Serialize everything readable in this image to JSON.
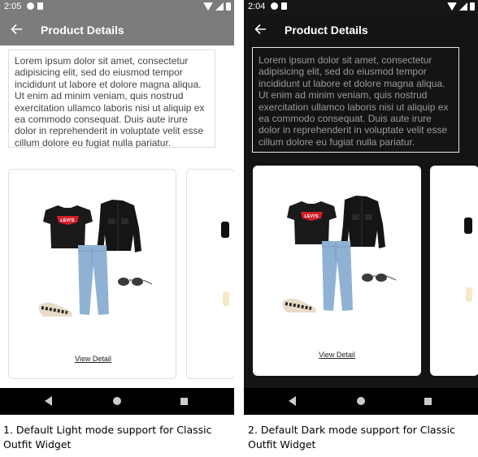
{
  "screens": [
    {
      "mode": "light",
      "status_time": "2:05",
      "header_title": "Product Details",
      "description": "Lorem ipsum dolor sit amet, consectetur adipisicing elit, sed do eiusmod tempor incididunt ut labore et dolore magna aliqua. Ut enim ad minim veniam, quis nostrud exercitation ullamco laboris nisi ut aliquip ex ea commodo consequat. Duis aute irure dolor in reprehenderit in voluptate velit esse cillum dolore eu fugiat nulla pariatur.",
      "card_link": "View Detail",
      "tshirt_brand": "LEVI'S",
      "caption": "1. Default Light mode support for Classic Outfit Widget"
    },
    {
      "mode": "dark",
      "status_time": "2:04",
      "header_title": "Product Details",
      "description": "Lorem ipsum dolor sit amet, consectetur adipisicing elit, sed do eiusmod tempor incididunt ut labore et dolore magna aliqua. Ut enim ad minim veniam, quis nostrud exercitation ullamco laboris nisi ut aliquip ex ea commodo consequat. Duis aute irure dolor in reprehenderit in voluptate velit esse cillum dolore eu fugiat nulla pariatur.",
      "card_link": "View Detail",
      "tshirt_brand": "LEVI'S",
      "caption": "2. Default Dark mode support for Classic Outfit Widget"
    }
  ],
  "colors": {
    "light_header": "#7c7c7c",
    "dark_background": "#141414",
    "tshirt_logo": "#d0202a",
    "jeans": "#8fb2d4"
  },
  "icons": {
    "back": "arrow-left-icon",
    "nav_back": "triangle-back-icon",
    "nav_home": "circle-home-icon",
    "nav_recents": "square-recents-icon"
  }
}
